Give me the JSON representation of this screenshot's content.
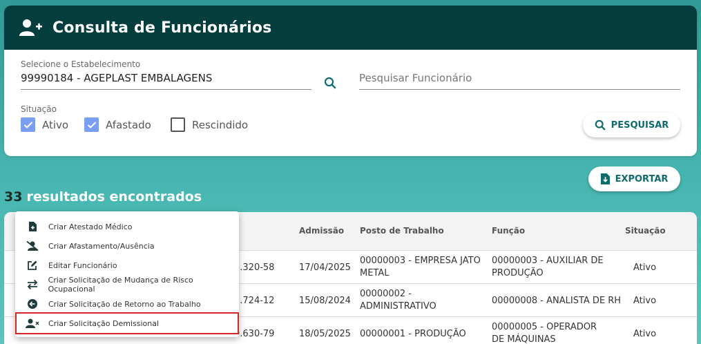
{
  "header": {
    "title": "Consulta de Funcionários",
    "icon": "user-plus-icon"
  },
  "filters": {
    "estabelecimento_label": "Selecione o Estabelecimento",
    "estabelecimento_value": "99990184 - AGEPLAST EMBALAGENS",
    "funcionario_placeholder": "Pesquisar Funcionário",
    "situacao_label": "Situação",
    "checkboxes": [
      {
        "label": "Ativo",
        "checked": true
      },
      {
        "label": "Afastado",
        "checked": true
      },
      {
        "label": "Rescindido",
        "checked": false
      }
    ],
    "search_button": "PESQUISAR"
  },
  "export_button": "EXPORTAR",
  "results": {
    "count": "33",
    "text": "resultados encontrados"
  },
  "table": {
    "columns": [
      "Admissão",
      "Posto de Trabalho",
      "Função",
      "Situação"
    ],
    "rows": [
      {
        "cpf_tail": "3.320-58",
        "admissao": "17/04/2025",
        "posto": "00000003 - EMPRESA JATO METAL",
        "funcao": "00000003 - AUXILIAR DE PRODUÇÃO",
        "situacao": "Ativo"
      },
      {
        "cpf_tail": "2.724-12",
        "admissao": "15/08/2024",
        "posto": "00000002 - ADMINISTRATIVO",
        "funcao": "00000008 - ANALISTA DE RH",
        "situacao": "Ativo"
      },
      {
        "cpf_tail": "9.630-79",
        "admissao": "18/05/2025",
        "posto": "00000001 - PRODUÇÃO",
        "funcao": "00000005 - OPERADOR DE MÁQUINAS",
        "situacao": "Ativo"
      }
    ]
  },
  "context_menu": {
    "items": [
      {
        "label": "Criar Atestado Médico",
        "icon": "file-plus-icon"
      },
      {
        "label": "Criar Afastamento/Ausência",
        "icon": "user-off-icon"
      },
      {
        "label": "Editar Funcionário",
        "icon": "edit-icon"
      },
      {
        "label": "Criar Solicitação de Mudança de Risco Ocupacional",
        "icon": "swap-icon"
      },
      {
        "label": "Criar Solicitação de Retorno ao Trabalho",
        "icon": "arrow-left-circle-icon"
      },
      {
        "label": "Criar Solicitação Demissional",
        "icon": "user-x-icon"
      }
    ]
  },
  "colors": {
    "header_bg": "#033d3e",
    "accent": "#0e6b6b",
    "checkbox": "#7a9ff2",
    "highlight": "#d6262b"
  }
}
